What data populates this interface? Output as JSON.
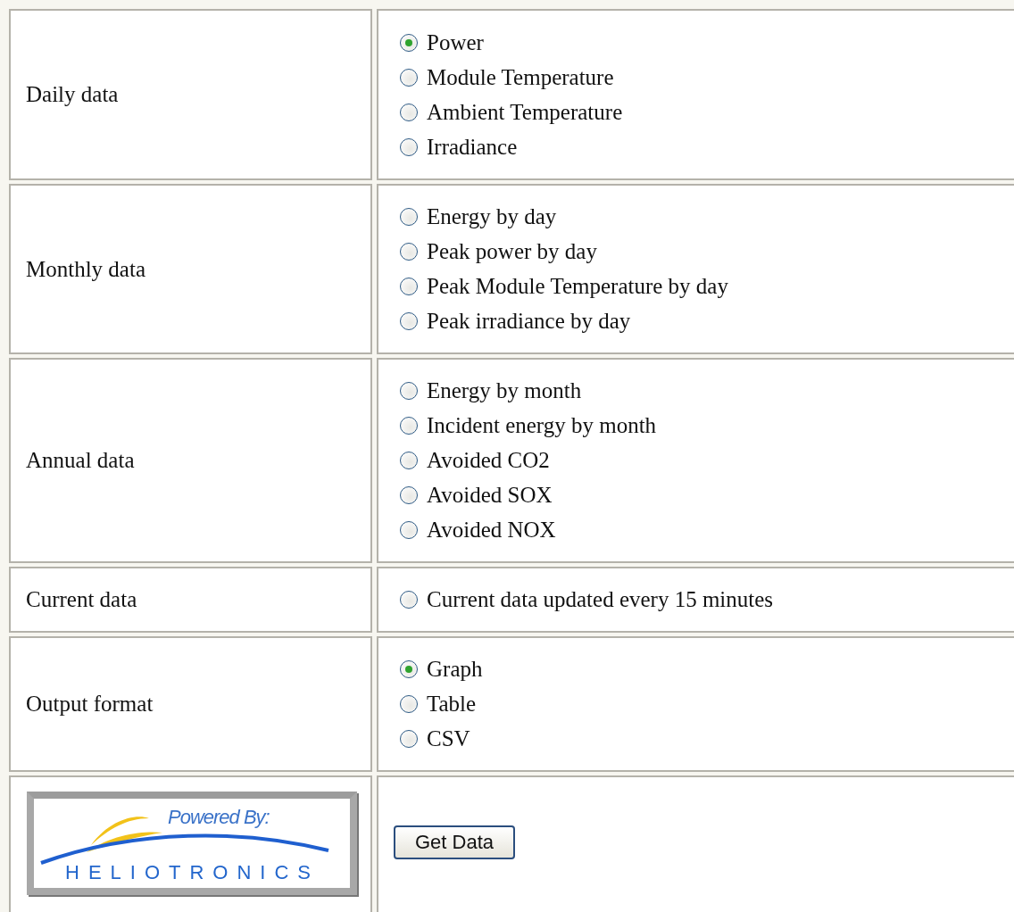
{
  "sections": [
    {
      "label": "Daily data",
      "options": [
        {
          "label": "Power",
          "selected": true
        },
        {
          "label": "Module Temperature",
          "selected": false
        },
        {
          "label": "Ambient Temperature",
          "selected": false
        },
        {
          "label": "Irradiance",
          "selected": false
        }
      ]
    },
    {
      "label": "Monthly data",
      "options": [
        {
          "label": "Energy by day",
          "selected": false
        },
        {
          "label": "Peak power by day",
          "selected": false
        },
        {
          "label": "Peak Module Temperature by day",
          "selected": false
        },
        {
          "label": "Peak irradiance by day",
          "selected": false
        }
      ]
    },
    {
      "label": "Annual data",
      "options": [
        {
          "label": "Energy by month",
          "selected": false
        },
        {
          "label": "Incident energy by month",
          "selected": false
        },
        {
          "label": "Avoided CO2",
          "selected": false
        },
        {
          "label": "Avoided SOX",
          "selected": false
        },
        {
          "label": "Avoided NOX",
          "selected": false
        }
      ]
    },
    {
      "label": "Current data",
      "options": [
        {
          "label": "Current data updated every 15 minutes",
          "selected": false
        }
      ]
    },
    {
      "label": "Output format",
      "options": [
        {
          "label": "Graph",
          "selected": true
        },
        {
          "label": "Table",
          "selected": false
        },
        {
          "label": "CSV",
          "selected": false
        }
      ]
    }
  ],
  "footer": {
    "logo": {
      "tagline": "Powered By:",
      "brand": "HELIOTRONICS"
    },
    "button": "Get Data"
  }
}
